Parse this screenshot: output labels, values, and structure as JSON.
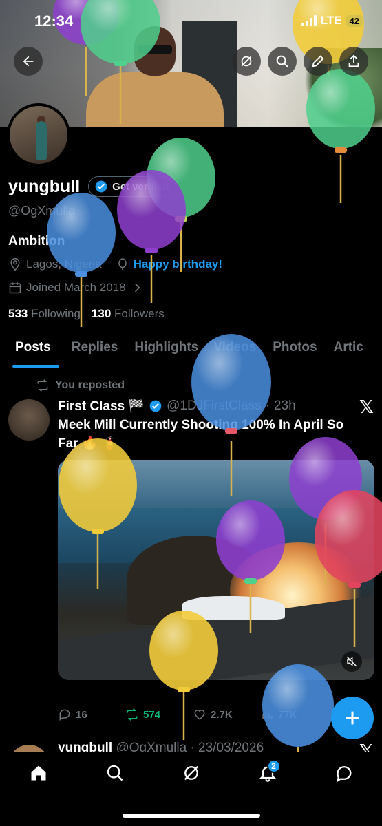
{
  "status_bar": {
    "time": "12:34",
    "network": "LTE",
    "battery": "42"
  },
  "profile": {
    "display_name": "yungbull",
    "get_verified_label": "Get verified",
    "handle": "@OgXmulla",
    "bio": "Ambition",
    "location": "Lagos, Nigeria",
    "birthday_text": "Happy birthday!",
    "joined": "Joined March 2018",
    "following_count": "533",
    "following_label": "Following",
    "followers_count": "130",
    "followers_label": "Followers"
  },
  "tabs": [
    {
      "label": "Posts"
    },
    {
      "label": "Replies"
    },
    {
      "label": "Highlights"
    },
    {
      "label": "Videos"
    },
    {
      "label": "Photos"
    },
    {
      "label": "Artic"
    }
  ],
  "post": {
    "repost_label": "You reposted",
    "author_name": "First Class 🏁",
    "author_handle": "@1DJFirstClass",
    "separator": "·",
    "time": "23h",
    "text": "Meek Mill Currently Shooting 100% In April So Far 🔥 🧯",
    "replies": "16",
    "reposts": "574",
    "likes": "2.7K",
    "views": "77K"
  },
  "next_post": {
    "author_name": "yungbull",
    "author_handle": "@OgXmulla",
    "date": "· 23/03/2026"
  },
  "notifications_badge": "2",
  "colors": {
    "accent": "#1d9bf0",
    "repost_green": "#00ba7c",
    "muted": "#71767b"
  }
}
